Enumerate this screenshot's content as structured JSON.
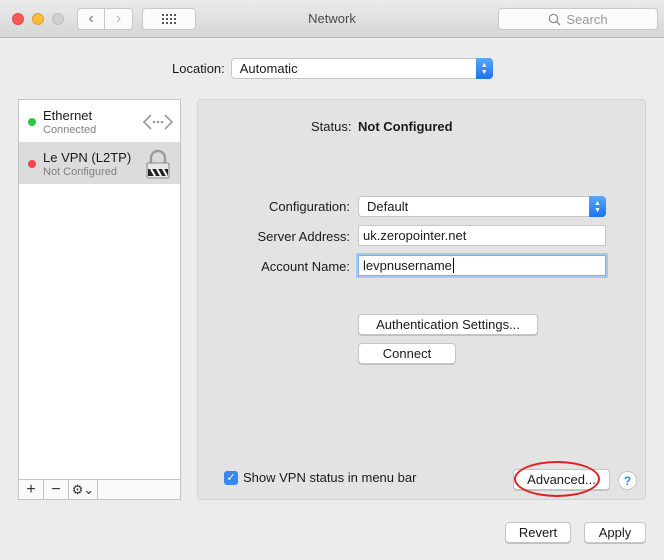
{
  "window": {
    "title": "Network",
    "search_placeholder": "Search"
  },
  "location": {
    "label": "Location:",
    "value": "Automatic"
  },
  "services": [
    {
      "name": "Ethernet",
      "status": "Connected",
      "dot_color": "#2ac840",
      "icon": "ethernet-icon",
      "selected": false
    },
    {
      "name": "Le VPN (L2TP)",
      "status": "Not Configured",
      "dot_color": "#f5424c",
      "icon": "vpn-lock-icon",
      "selected": true
    }
  ],
  "sidebar_toolbar": {
    "add": "+",
    "remove": "−",
    "gear": "⚙⌄"
  },
  "detail": {
    "status_label": "Status:",
    "status_value": "Not Configured",
    "configuration_label": "Configuration:",
    "configuration_value": "Default",
    "server_label": "Server Address:",
    "server_value": "uk.zeropointer.net",
    "account_label": "Account Name:",
    "account_value": "levpnusername",
    "auth_button": "Authentication Settings...",
    "connect_button": "Connect",
    "show_vpn_label": "Show VPN status in menu bar",
    "show_vpn_checked": true,
    "advanced_button": "Advanced...",
    "help": "?"
  },
  "footer": {
    "revert": "Revert",
    "apply": "Apply"
  },
  "colors": {
    "accent": "#3b87f0",
    "annotation": "#e02020"
  }
}
